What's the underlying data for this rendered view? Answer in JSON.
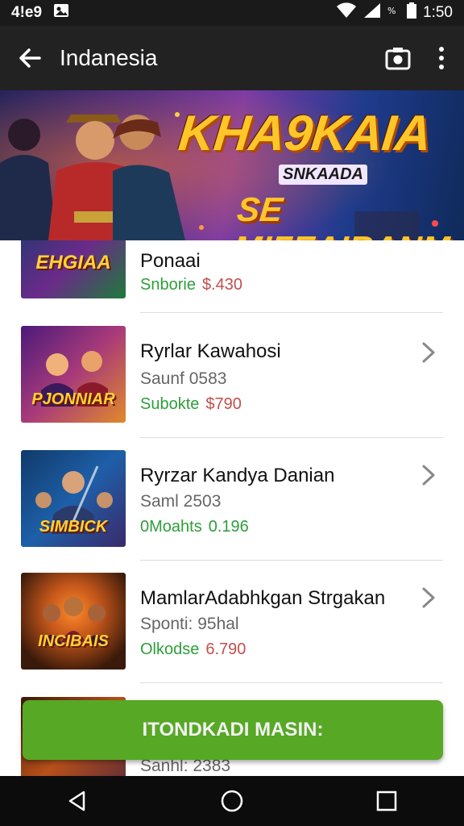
{
  "status_bar": {
    "left_text": "4!e9",
    "notification_icon": "image-notification-icon",
    "time": "1:50"
  },
  "app_bar": {
    "title": "Indanesia",
    "back_icon": "arrow-left-icon",
    "camera_icon": "camera-icon",
    "more_icon": "more-vert-icon"
  },
  "banner": {
    "title": "KHA9KAIA",
    "subtitle": "SNKAADA",
    "tagline": "SE MIFEAIRANM"
  },
  "items": [
    {
      "thumb_label": "EHGIAA",
      "title": "Ponaai",
      "meta": "",
      "price_label": "Snborie",
      "price_value": "$.430",
      "has_chevron": false,
      "thumb_colors": [
        "#143a6b",
        "#6b2a8a",
        "#1e7a3a"
      ]
    },
    {
      "thumb_label": "PJONNIAR",
      "title": "Ryrlar Kawahosi",
      "meta": "Saunf 0583",
      "price_label": "Subokte",
      "price_value": "$790",
      "has_chevron": true,
      "thumb_colors": [
        "#4a1a7a",
        "#a83a7a",
        "#e08a2a"
      ]
    },
    {
      "thumb_label": "SIMBICK",
      "title": "Ryrzar Kandya Danian",
      "meta": "Saml 2503",
      "price_label": "0Moahts",
      "price_value": "0.196",
      "has_chevron": true,
      "thumb_colors": [
        "#0f3a6a",
        "#1e5fa8",
        "#3a2a6a"
      ]
    },
    {
      "thumb_label": "INCIBAIS",
      "title": "MamlarAdabhkgan Strgakan",
      "meta": "Sponti: 95hal",
      "price_label": "Olkodse",
      "price_value": "6.790",
      "has_chevron": true,
      "thumb_colors": [
        "#3a1a0a",
        "#c2551a",
        "#7a2a1a"
      ]
    },
    {
      "thumb_label": "",
      "title": "",
      "meta": "Sanhl: 2383",
      "price_label": "",
      "price_value": "",
      "has_chevron": false,
      "thumb_colors": [
        "#3a1a0a",
        "#b8501a",
        "#5a2a3a"
      ]
    }
  ],
  "cta": {
    "label": "ITONDKADI MASIN:"
  },
  "nav_bar": {
    "back_icon": "triangle-back-icon",
    "home_icon": "circle-home-icon",
    "recents_icon": "square-recents-icon"
  },
  "colors": {
    "status_bg": "#1a1a1a",
    "app_bar_bg": "#222222",
    "cta_bg": "#57a825",
    "price_green": "#2e9e3a",
    "price_red": "#c0504d",
    "nav_bg": "#0c0c0c"
  }
}
